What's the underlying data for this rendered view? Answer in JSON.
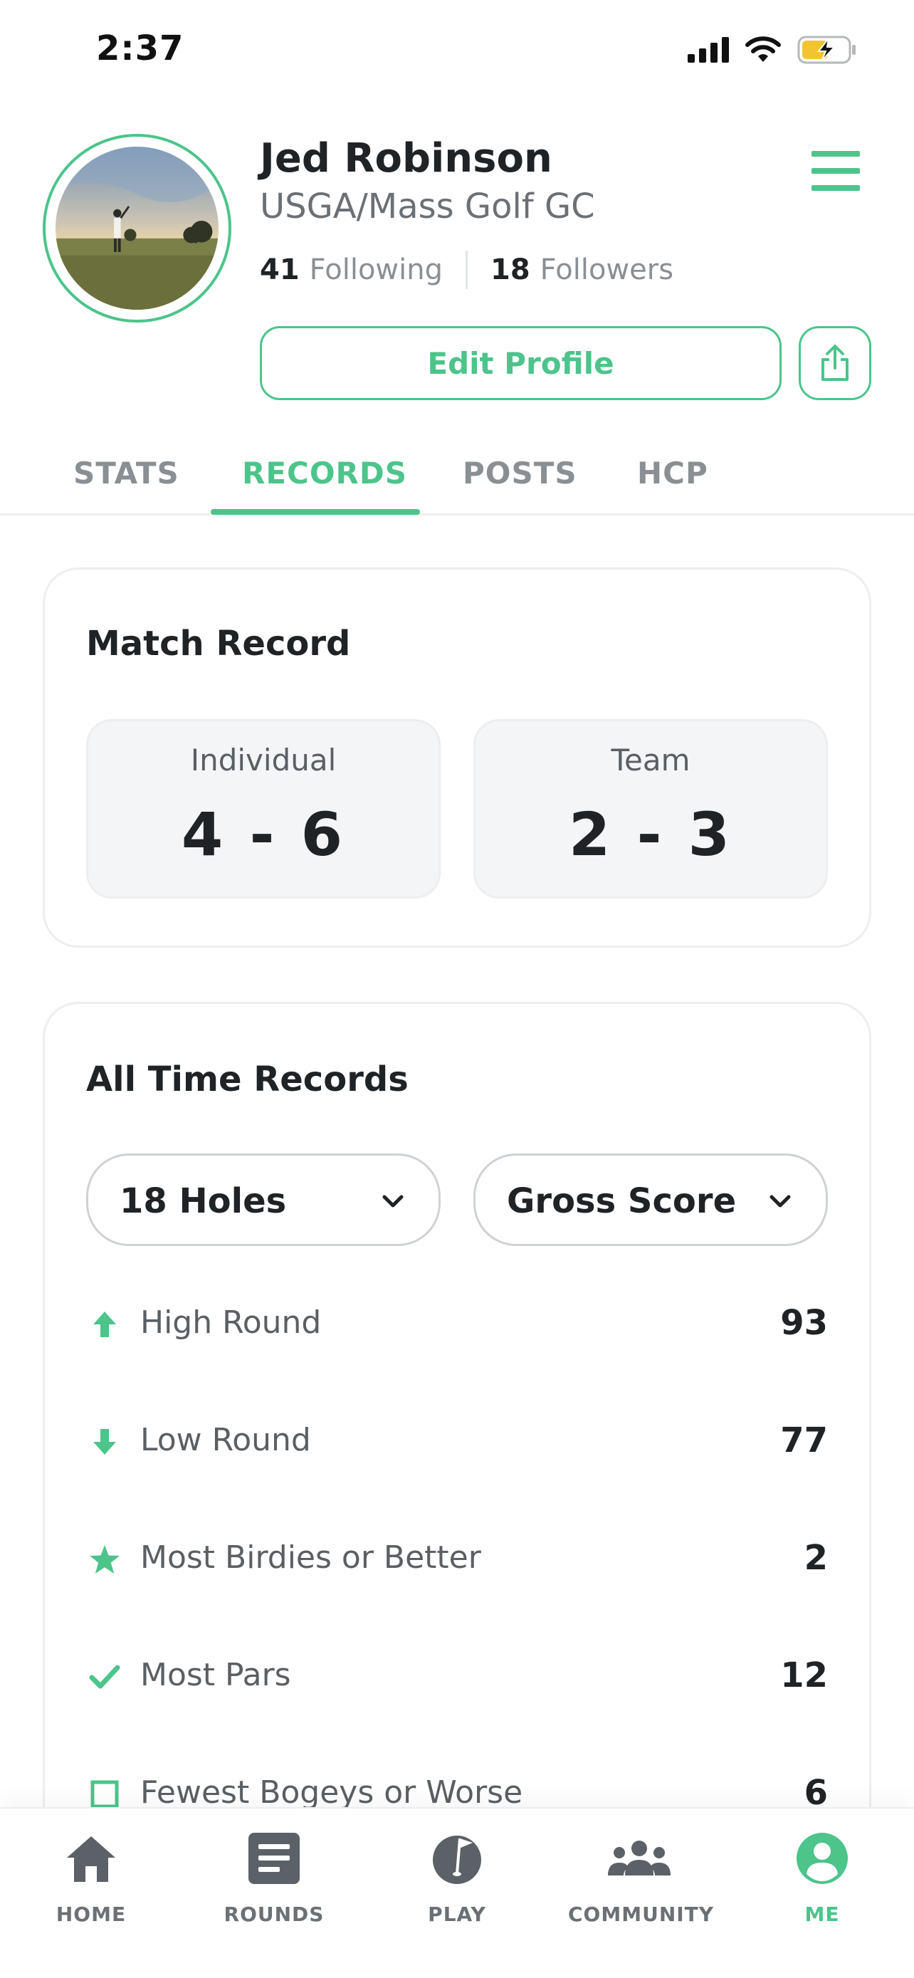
{
  "status_bar": {
    "time": "2:37"
  },
  "profile": {
    "name": "Jed Robinson",
    "club": "USGA/Mass Golf GC",
    "following_count": "41",
    "following_label": "Following",
    "followers_count": "18",
    "followers_label": "Followers",
    "edit_button_label": "Edit Profile"
  },
  "tabs": [
    {
      "label": "STATS",
      "active": false
    },
    {
      "label": "RECORDS",
      "active": true
    },
    {
      "label": "POSTS",
      "active": false
    },
    {
      "label": "HCP",
      "active": false
    }
  ],
  "match_record": {
    "title": "Match Record",
    "individual_label": "Individual",
    "individual_value": "4 - 6",
    "team_label": "Team",
    "team_value": "2 - 3"
  },
  "all_time_records": {
    "title": "All Time Records",
    "holes_filter": "18 Holes",
    "score_filter": "Gross Score",
    "rows": [
      {
        "icon": "arrow-up-icon",
        "label": "High Round",
        "value": "93"
      },
      {
        "icon": "arrow-down-icon",
        "label": "Low Round",
        "value": "77"
      },
      {
        "icon": "star-icon",
        "label": "Most Birdies or Better",
        "value": "2"
      },
      {
        "icon": "checkmark-icon",
        "label": "Most Pars",
        "value": "12"
      },
      {
        "icon": "square-icon",
        "label": "Fewest Bogeys or Worse",
        "value": "6"
      }
    ]
  },
  "bottom_nav": [
    {
      "label": "HOME",
      "icon": "home-icon",
      "active": false
    },
    {
      "label": "ROUNDS",
      "icon": "scorecard-icon",
      "active": false
    },
    {
      "label": "PLAY",
      "icon": "golf-ball-flag-icon",
      "active": false
    },
    {
      "label": "COMMUNITY",
      "icon": "community-icon",
      "active": false
    },
    {
      "label": "ME",
      "icon": "user-icon",
      "active": true
    }
  ],
  "colors": {
    "accent": "#4cc48a",
    "text": "#1f2326",
    "muted": "#8a8f94"
  }
}
